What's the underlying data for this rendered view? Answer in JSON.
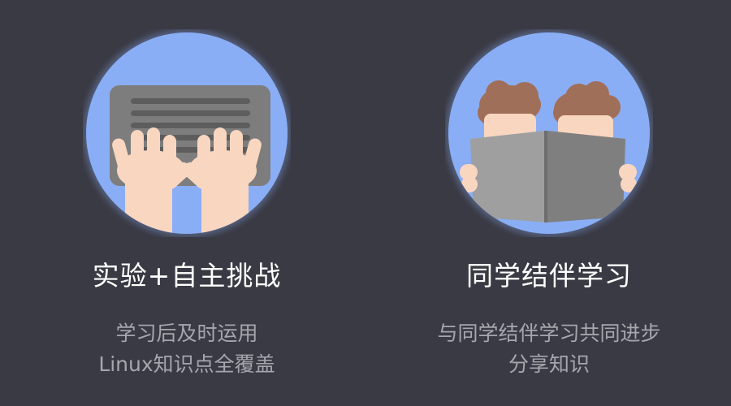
{
  "colors": {
    "background": "#3a3a44",
    "circle": "#8aaef5",
    "title": "#ffffff",
    "description": "#a6a6ac",
    "skin": "#f9d6c0",
    "device_gray": "#7d7d7d",
    "hair_brown": "#a06f5a"
  },
  "features": [
    {
      "icon": "typing-hands-icon",
      "title": "实验+自主挑战",
      "description_lines": [
        "学习后及时运用",
        "Linux知识点全覆盖"
      ]
    },
    {
      "icon": "reading-together-icon",
      "title": "同学结伴学习",
      "description_lines": [
        "与同学结伴学习共同进步",
        "分享知识"
      ]
    }
  ]
}
